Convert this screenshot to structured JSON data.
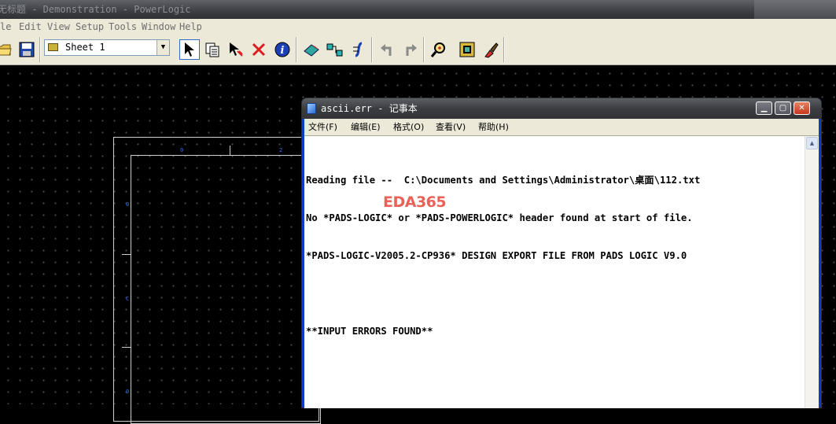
{
  "app": {
    "title": "无标题 - Demonstration - PowerLogic"
  },
  "menubar": {
    "items": [
      {
        "label": "le",
        "name": "file"
      },
      {
        "label": "Edit",
        "name": "edit"
      },
      {
        "label": "View",
        "name": "view"
      },
      {
        "label": "Setup",
        "name": "setup"
      },
      {
        "label": "Tools",
        "name": "tools"
      },
      {
        "label": "Window",
        "name": "window"
      },
      {
        "label": "Help",
        "name": "help"
      }
    ]
  },
  "toolbar": {
    "sheet_selected": "Sheet 1",
    "buttons": [
      {
        "name": "open-icon",
        "glyph": "📂"
      },
      {
        "name": "save-icon",
        "glyph": "💾"
      },
      {
        "name": "select-arrow-icon",
        "glyph": "↖"
      },
      {
        "name": "copy-icon",
        "glyph": "⎘"
      },
      {
        "name": "select-filter-icon",
        "glyph": "↖"
      },
      {
        "name": "delete-icon",
        "glyph": "✕"
      },
      {
        "name": "info-icon",
        "glyph": "i"
      },
      {
        "name": "add-part-icon",
        "glyph": "◆"
      },
      {
        "name": "add-connection-icon",
        "glyph": "⇉"
      },
      {
        "name": "add-bus-icon",
        "glyph": "∫"
      },
      {
        "name": "undo-icon",
        "glyph": "↶"
      },
      {
        "name": "redo-icon",
        "glyph": "↷"
      },
      {
        "name": "find-icon",
        "glyph": "🔍"
      },
      {
        "name": "zoom-icon",
        "glyph": "▣"
      },
      {
        "name": "paint-icon",
        "glyph": "🖌"
      }
    ]
  },
  "notepad": {
    "title": "ascii.err - 记事本",
    "menu": [
      {
        "label": "文件(F)",
        "name": "file"
      },
      {
        "label": "编辑(E)",
        "name": "edit"
      },
      {
        "label": "格式(O)",
        "name": "format"
      },
      {
        "label": "查看(V)",
        "name": "view"
      },
      {
        "label": "帮助(H)",
        "name": "help"
      }
    ],
    "lines": [
      "Reading file --  C:\\Documents and Settings\\Administrator\\桌面\\112.txt",
      "No *PADS-LOGIC* or *PADS-POWERLOGIC* header found at start of file.",
      "*PADS-LOGIC-V2005.2-CP936* DESIGN EXPORT FILE FROM PADS LOGIC V9.0",
      "",
      "**INPUT ERRORS FOUND**"
    ]
  },
  "watermark": "EDA365",
  "colors": {
    "canvas_bg": "#000000",
    "grid_dot": "#4b4b4b",
    "sheet_border": "#cfcfcf",
    "marker": "#2a6cff",
    "watermark": "#e4473c"
  }
}
